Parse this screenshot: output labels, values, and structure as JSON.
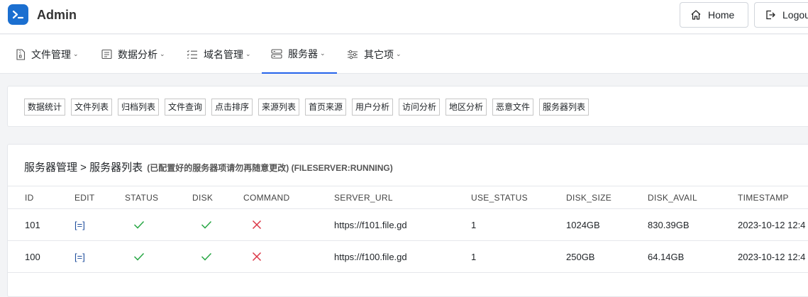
{
  "header": {
    "app_title": "Admin",
    "home_label": "Home",
    "logout_label": "Logout"
  },
  "nav": {
    "items": [
      {
        "label": "文件管理"
      },
      {
        "label": "数据分析"
      },
      {
        "label": "域名管理"
      },
      {
        "label": "服务器",
        "active": true
      },
      {
        "label": "其它项"
      }
    ]
  },
  "subtabs": [
    "数据统计",
    "文件列表",
    "归档列表",
    "文件查询",
    "点击排序",
    "来源列表",
    "首页来源",
    "用户分析",
    "访问分析",
    "地区分析",
    "恶意文件",
    "服务器列表"
  ],
  "page": {
    "title": "服务器管理 > 服务器列表",
    "note": "(已配置好的服务器项请勿再随意更改) (FILESERVER:RUNNING)"
  },
  "table": {
    "columns": [
      "ID",
      "EDIT",
      "STATUS",
      "DISK",
      "COMMAND",
      "SERVER_URL",
      "USE_STATUS",
      "DISK_SIZE",
      "DISK_AVAIL",
      "TIMESTAMP"
    ],
    "rows": [
      {
        "id": "101",
        "edit": "[=]",
        "status": "check",
        "disk": "check",
        "command": "cross",
        "server_url": "https://f101.file.gd",
        "use_status": "1",
        "disk_size": "1024GB",
        "disk_avail": "830.39GB",
        "timestamp": "2023-10-12 12:4"
      },
      {
        "id": "100",
        "edit": "[=]",
        "status": "check",
        "disk": "check",
        "command": "cross",
        "server_url": "https://f100.file.gd",
        "use_status": "1",
        "disk_size": "250GB",
        "disk_avail": "64.14GB",
        "timestamp": "2023-10-12 12:4"
      }
    ]
  },
  "colors": {
    "brand": "#1b6fd0",
    "active_nav": "#2563eb",
    "check": "#28a745",
    "cross": "#dc3545",
    "link": "#1f4e9c"
  }
}
